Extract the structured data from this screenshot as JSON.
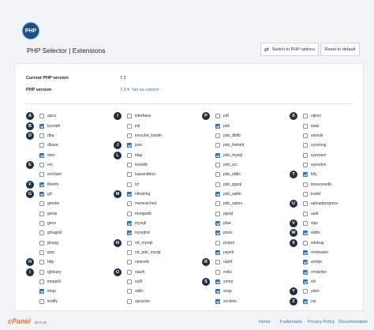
{
  "header": {
    "logo_text": "PHP",
    "title": "PHP Selector | Extensions",
    "switch_button": "Switch to PHP options",
    "reset_button": "Reset to default"
  },
  "info": {
    "current_label": "Current PHP version",
    "current_value": "7.2",
    "version_label": "PHP version",
    "version_value": "7.3 ▾",
    "set_current": "Set as current"
  },
  "columns": [
    [
      {
        "letter": "A",
        "name": "apcu",
        "checked": false
      },
      {
        "letter": "B",
        "name": "bcmath",
        "checked": true
      },
      {
        "letter": "D",
        "name": "dba",
        "checked": false
      },
      {
        "letter": "",
        "name": "dbase",
        "checked": false
      },
      {
        "letter": "",
        "name": "dom",
        "checked": true
      },
      {
        "letter": "E",
        "name": "eio",
        "checked": false
      },
      {
        "letter": "",
        "name": "enchant",
        "checked": false
      },
      {
        "letter": "F",
        "name": "fileinfo",
        "checked": true
      },
      {
        "letter": "G",
        "name": "gd",
        "checked": true
      },
      {
        "letter": "",
        "name": "gender",
        "checked": false
      },
      {
        "letter": "",
        "name": "geoip",
        "checked": false
      },
      {
        "letter": "",
        "name": "geos",
        "checked": false
      },
      {
        "letter": "",
        "name": "gmagick",
        "checked": false
      },
      {
        "letter": "",
        "name": "gnupg",
        "checked": false
      },
      {
        "letter": "",
        "name": "grpc",
        "checked": false
      },
      {
        "letter": "H",
        "name": "http",
        "checked": false
      },
      {
        "letter": "I",
        "name": "igbinary",
        "checked": false
      },
      {
        "letter": "",
        "name": "imagick",
        "checked": false
      },
      {
        "letter": "",
        "name": "imap",
        "checked": true
      },
      {
        "letter": "",
        "name": "inotify",
        "checked": false
      }
    ],
    [
      {
        "letter": "I",
        "name": "interbase",
        "checked": false
      },
      {
        "letter": "",
        "name": "intl",
        "checked": false
      },
      {
        "letter": "",
        "name": "ioncube_loader",
        "checked": false
      },
      {
        "letter": "J",
        "name": "json",
        "checked": true
      },
      {
        "letter": "L",
        "name": "ldap",
        "checked": false
      },
      {
        "letter": "",
        "name": "leveldb",
        "checked": false
      },
      {
        "letter": "",
        "name": "luasandbox",
        "checked": false
      },
      {
        "letter": "",
        "name": "lzf",
        "checked": false
      },
      {
        "letter": "M",
        "name": "mbstring",
        "checked": true
      },
      {
        "letter": "",
        "name": "memcached",
        "checked": false
      },
      {
        "letter": "",
        "name": "mongodb",
        "checked": false
      },
      {
        "letter": "",
        "name": "mysqli",
        "checked": true
      },
      {
        "letter": "",
        "name": "mysqlnd",
        "checked": true
      },
      {
        "letter": "N",
        "name": "nd_mysqli",
        "checked": false
      },
      {
        "letter": "",
        "name": "nd_pdo_mysql",
        "checked": false
      },
      {
        "letter": "",
        "name": "newrelic",
        "checked": false
      },
      {
        "letter": "O",
        "name": "oauth",
        "checked": false
      },
      {
        "letter": "",
        "name": "oci8",
        "checked": false
      },
      {
        "letter": "",
        "name": "odbc",
        "checked": false
      },
      {
        "letter": "",
        "name": "opcache",
        "checked": false
      }
    ],
    [
      {
        "letter": "P",
        "name": "pdf",
        "checked": false
      },
      {
        "letter": "",
        "name": "pdo",
        "checked": true
      },
      {
        "letter": "",
        "name": "pdo_dblib",
        "checked": false
      },
      {
        "letter": "",
        "name": "pdo_firebird",
        "checked": false
      },
      {
        "letter": "",
        "name": "pdo_mysql",
        "checked": true
      },
      {
        "letter": "",
        "name": "pdo_oci",
        "checked": false
      },
      {
        "letter": "",
        "name": "pdo_odbc",
        "checked": false
      },
      {
        "letter": "",
        "name": "pdo_pgsql",
        "checked": false
      },
      {
        "letter": "",
        "name": "pdo_sqlite",
        "checked": true
      },
      {
        "letter": "",
        "name": "pdo_sqlsrv",
        "checked": false
      },
      {
        "letter": "",
        "name": "pgsql",
        "checked": false
      },
      {
        "letter": "",
        "name": "phar",
        "checked": true
      },
      {
        "letter": "",
        "name": "posix",
        "checked": true
      },
      {
        "letter": "",
        "name": "propro",
        "checked": false
      },
      {
        "letter": "",
        "name": "pspell",
        "checked": true
      },
      {
        "letter": "R",
        "name": "raphf",
        "checked": false
      },
      {
        "letter": "",
        "name": "redis",
        "checked": false
      },
      {
        "letter": "S",
        "name": "snmp",
        "checked": true
      },
      {
        "letter": "",
        "name": "soap",
        "checked": true
      },
      {
        "letter": "",
        "name": "sockets",
        "checked": true
      }
    ],
    [
      {
        "letter": "S",
        "name": "sqlsrv",
        "checked": false
      },
      {
        "letter": "",
        "name": "stats",
        "checked": false
      },
      {
        "letter": "",
        "name": "swoole",
        "checked": false
      },
      {
        "letter": "",
        "name": "sysvmsg",
        "checked": false
      },
      {
        "letter": "",
        "name": "sysvsem",
        "checked": false
      },
      {
        "letter": "",
        "name": "sysvshm",
        "checked": false
      },
      {
        "letter": "T",
        "name": "tidy",
        "checked": true
      },
      {
        "letter": "",
        "name": "timezonedb",
        "checked": false
      },
      {
        "letter": "",
        "name": "trader",
        "checked": false
      },
      {
        "letter": "U",
        "name": "uploadprogress",
        "checked": false
      },
      {
        "letter": "",
        "name": "uuid",
        "checked": false
      },
      {
        "letter": "V",
        "name": "vips",
        "checked": false
      },
      {
        "letter": "W",
        "name": "wddx",
        "checked": true
      },
      {
        "letter": "X",
        "name": "xdebug",
        "checked": false
      },
      {
        "letter": "",
        "name": "xmlreader",
        "checked": true
      },
      {
        "letter": "",
        "name": "xmlrpc",
        "checked": true
      },
      {
        "letter": "",
        "name": "xmlwriter",
        "checked": true
      },
      {
        "letter": "",
        "name": "xsl",
        "checked": true
      },
      {
        "letter": "Y",
        "name": "yaml",
        "checked": false
      },
      {
        "letter": "Z",
        "name": "zip",
        "checked": true
      }
    ]
  ],
  "footer": {
    "brand": "cPanel",
    "version": "82.0.15",
    "links": [
      "Home",
      "Trademarks",
      "Privacy Policy",
      "Documentation"
    ]
  },
  "colors": {
    "accent": "#2a74c4",
    "letter_badge": "#1f2f3d",
    "cpanel_orange": "#ff6c2c"
  }
}
